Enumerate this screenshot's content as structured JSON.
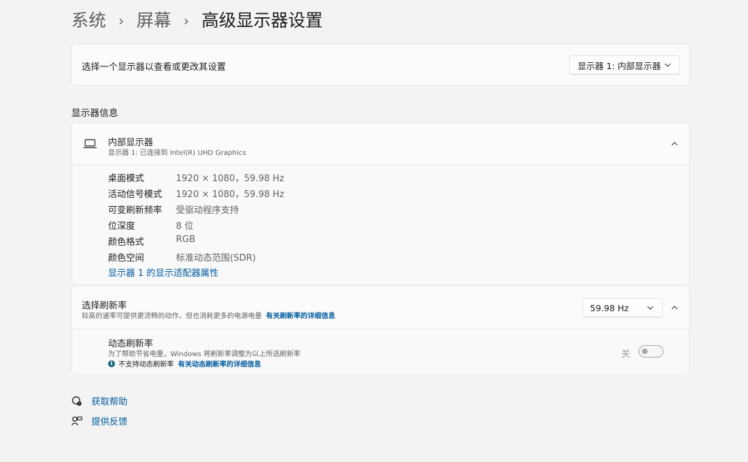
{
  "breadcrumb": {
    "items": [
      "系统",
      "屏幕"
    ],
    "separator": "›",
    "current": "高级显示器设置"
  },
  "display_select": {
    "label": "选择一个显示器以查看或更改其设置",
    "value": "显示器 1: 内部显示器"
  },
  "display_info": {
    "section_title": "显示器信息",
    "name": "内部显示器",
    "subtitle": "显示器 1: 已连接到 Intel(R) UHD Graphics",
    "rows": [
      {
        "key": "桌面模式",
        "value": "1920 × 1080，59.98 Hz"
      },
      {
        "key": "活动信号模式",
        "value": "1920 × 1080，59.98 Hz"
      },
      {
        "key": "可变刷新频率",
        "value": "受驱动程序支持"
      },
      {
        "key": "位深度",
        "value": "8 位"
      },
      {
        "key": "颜色格式",
        "value": "RGB"
      },
      {
        "key": "颜色空间",
        "value": "标准动态范围(SDR)"
      }
    ],
    "adapter_link": "显示器 1 的显示适配器属性"
  },
  "refresh_rate": {
    "title": "选择刷新率",
    "subtitle": "较高的速率可提供更流畅的动作，但也消耗更多的电源电量",
    "link": "有关刷新率的详细信息",
    "value": "59.98 Hz",
    "dynamic": {
      "title": "动态刷新率",
      "subtitle": "为了帮助节省电量，Windows 将刷新率调整为以上所选刷新率",
      "note": "不支持动态刷新率",
      "note_link": "有关动态刷新率的详细信息",
      "toggle_label": "关",
      "toggle_on": false
    }
  },
  "footer": {
    "help": "获取帮助",
    "feedback": "提供反馈"
  },
  "colors": {
    "background": "#f3f3f3",
    "card": "#fbfbfb",
    "link": "#005a9e",
    "secondary_text": "#5f5f5f"
  }
}
